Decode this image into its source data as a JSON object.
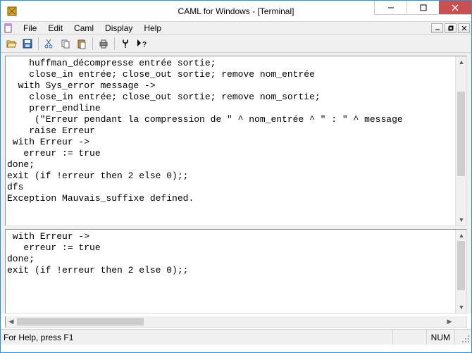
{
  "window": {
    "title": "CAML for Windows - [Terminal]"
  },
  "menu": {
    "file": "File",
    "edit": "Edit",
    "caml": "Caml",
    "display": "Display",
    "help": "Help"
  },
  "toolbar_icons": {
    "open": "open-icon",
    "save": "save-icon",
    "cut": "cut-icon",
    "copy": "copy-icon",
    "paste": "paste-icon",
    "print": "print-icon",
    "about": "about-icon",
    "context_help": "context-help-icon"
  },
  "panes": {
    "top_lines": [
      "    huffman_décompresse entrée sortie;",
      "    close_in entrée; close_out sortie; remove nom_entrée",
      "  with Sys_error message ->",
      "    close_in entrée; close_out sortie; remove nom_sortie;",
      "    prerr_endline",
      "     (\"Erreur pendant la compression de \" ^ nom_entrée ^ \" : \" ^ message",
      "    raise Erreur",
      " with Erreur ->",
      "   erreur := true",
      "done;",
      "exit (if !erreur then 2 else 0);;",
      "dfs",
      "Exception Mauvais_suffixe defined."
    ],
    "bottom_lines": [
      " with Erreur ->",
      "   erreur := true",
      "done;",
      "exit (if !erreur then 2 else 0);;",
      ""
    ]
  },
  "status": {
    "help": "For Help, press F1",
    "num": "NUM",
    "blank": ""
  }
}
